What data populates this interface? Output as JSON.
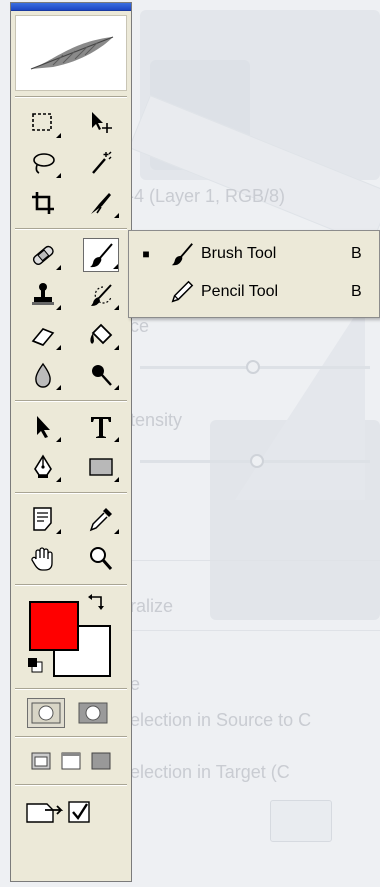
{
  "background_window": {
    "title_fragment": "-4 (Layer 1, RGB/8)",
    "labels": [
      "ce",
      "tensity",
      "ralize",
      "e",
      "election in Source to C",
      "election in Target (C"
    ]
  },
  "toolbox": {
    "tools": [
      [
        "marquee",
        "move"
      ],
      [
        "lasso",
        "magic-wand"
      ],
      [
        "crop",
        "slice"
      ],
      [
        "healing",
        "brush"
      ],
      [
        "stamp",
        "history-brush"
      ],
      [
        "eraser",
        "paint-bucket"
      ],
      [
        "blur",
        "dodge"
      ],
      [
        "path-select",
        "type"
      ],
      [
        "pen",
        "rectangle"
      ],
      [
        "notes",
        "eyedropper"
      ],
      [
        "hand",
        "zoom"
      ]
    ],
    "foreground_color": "#ff0000",
    "background_color": "#ffffff"
  },
  "flyout": {
    "items": [
      {
        "label": "Brush Tool",
        "shortcut": "B",
        "checked_mark": "■"
      },
      {
        "label": "Pencil Tool",
        "shortcut": "B",
        "checked_mark": ""
      }
    ]
  }
}
